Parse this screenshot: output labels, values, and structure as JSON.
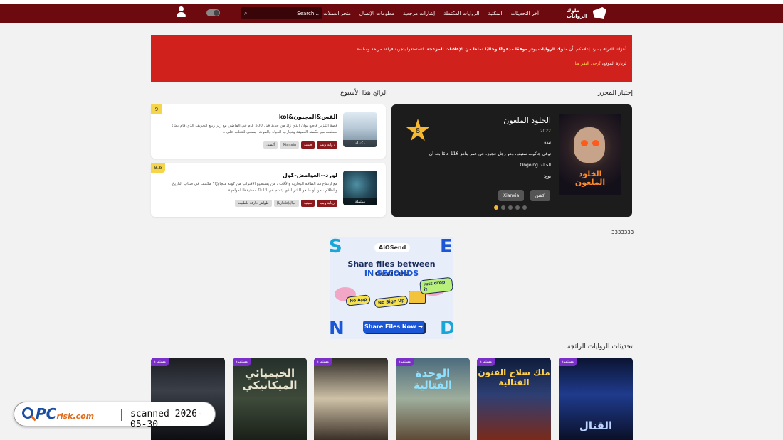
{
  "nav": {
    "logo_text": "ملوك الروايات",
    "menu": [
      "آخر التحديثات",
      "المكتبة",
      "الروايات المكتملة",
      "إشارات مرجعية",
      "معلومات الإتصال",
      "متجر العملات"
    ],
    "search_placeholder": "Search..."
  },
  "alert": {
    "line1_a": "أعزائنا القراء، يسرنا إعلامكم بأن ",
    "line1_b": "ملوك الروايات",
    "line1_c": " يوفر ",
    "line1_d": "موقعًا مدفوعًا وخاليًا تمامًا من الإعلانات المزعجة",
    "line1_e": "، لتستمتعوا بتجربة قراءة مريحة وسلسة.",
    "line2_a": "لزيارة الموقع، ",
    "line2_b": "يُرجى النقر هنا",
    "line2_c": "."
  },
  "sections": {
    "editor_choice": "إختيار المحرر",
    "weekly_trending": "الرائج هذا الأسبوع",
    "trending_updates": "تحديثات الروايات الرائجة"
  },
  "featured": {
    "title": "الخلود الملعون",
    "year": "2022",
    "summary_label": "نبذة",
    "summary": "توفي جاكوب ستيف، وهو رجل عجوز، عن عمر يناهز 116 عامًا بعد أن",
    "status": "الحالة: Ongoing",
    "type": "نوع:",
    "rating": "8",
    "poster_text": "الخلود الملعون",
    "tags": [
      "أكشن",
      "Xianxia"
    ]
  },
  "weekly": [
    {
      "score": "9",
      "title": "القس&المجنون&kol",
      "desc": "قصة التنزير قاطع يوان الذي زاد من جديد قبل 500 عام في الماضي مع زير ربيع الخريف الذي قام بعثاء بعطفه، مع حكمته العميقة وتجارب الحياة والموت، يسعى للتغلب على...",
      "thumb_caption": "مكتملة",
      "tags": [
        "رواية ويب",
        "صينية",
        "Xianxia",
        "أكشن"
      ]
    },
    {
      "score": "9.6",
      "title": "لورد--الغوامض-كول",
      "desc": "مع ارتفاع مد الطاقة البخارية والآلات ، من يستطيع الاقتراب من كونه متجاوزًا؟ مكتنف في ضباب التاريخ والظلام ، من أو ما هو الشر الذي يتمتم في اذاننا؟ مستيقظا لمواجهة...",
      "thumb_caption": "مكتملة",
      "tags": [
        "رواية ويب",
        "صينية",
        "خيال(فانتازيا)",
        "ظواهر خارقة للطبيعة"
      ]
    }
  ],
  "misc_number": "3333333",
  "ad": {
    "brand": "AiOSend",
    "line1": "Share files between devices",
    "line2": "IN SECONDS",
    "pill_noapp": "No App",
    "pill_nosignup": "No Sign Up",
    "pill_drop": "Just drop it",
    "cta": "Share Files Now →",
    "letter_s": "S",
    "letter_e": "E",
    "letter_n": "N",
    "letter_d": "D"
  },
  "covers": [
    {
      "status": "مستمرة",
      "title": ""
    },
    {
      "status": "مستمرة",
      "title": "الخيميائي الميكانيكي"
    },
    {
      "status": "مستمرة",
      "title": ""
    },
    {
      "status": "مستمرة",
      "title": "الوحدة الفتالية"
    },
    {
      "status": "مستمرة",
      "title": "ملك سلاح الفنون القتالية"
    },
    {
      "status": "مستمرة",
      "title": "القتال"
    }
  ],
  "watermark": {
    "brand_a": "PC",
    "brand_b": "risk.com",
    "scanned": "scanned 2026-05-30"
  }
}
